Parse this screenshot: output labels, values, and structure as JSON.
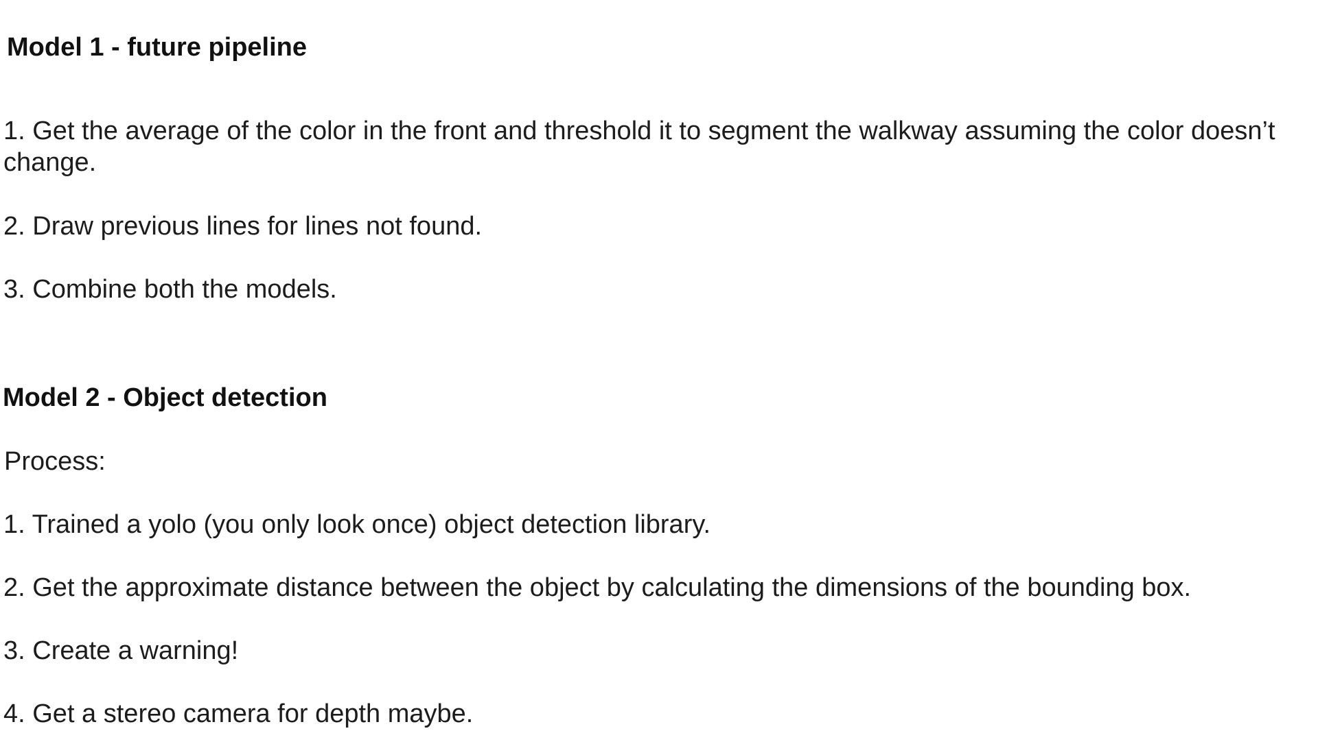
{
  "section1": {
    "heading": "Model 1 - future pipeline",
    "items": [
      "1. Get the average of the color in the front and threshold it to segment the walkway assuming the color doesn’t change.",
      "2. Draw previous lines for lines not found.",
      "3. Combine both the models."
    ]
  },
  "section2": {
    "heading": "Model 2 - Object detection",
    "intro": "Process:",
    "items": [
      "1. Trained a yolo (you only look once) object detection library.",
      "2. Get the approximate distance between the object by calculating the dimensions of the bounding box.",
      "3. Create a warning!",
      "4. Get a stereo camera for depth maybe."
    ]
  }
}
